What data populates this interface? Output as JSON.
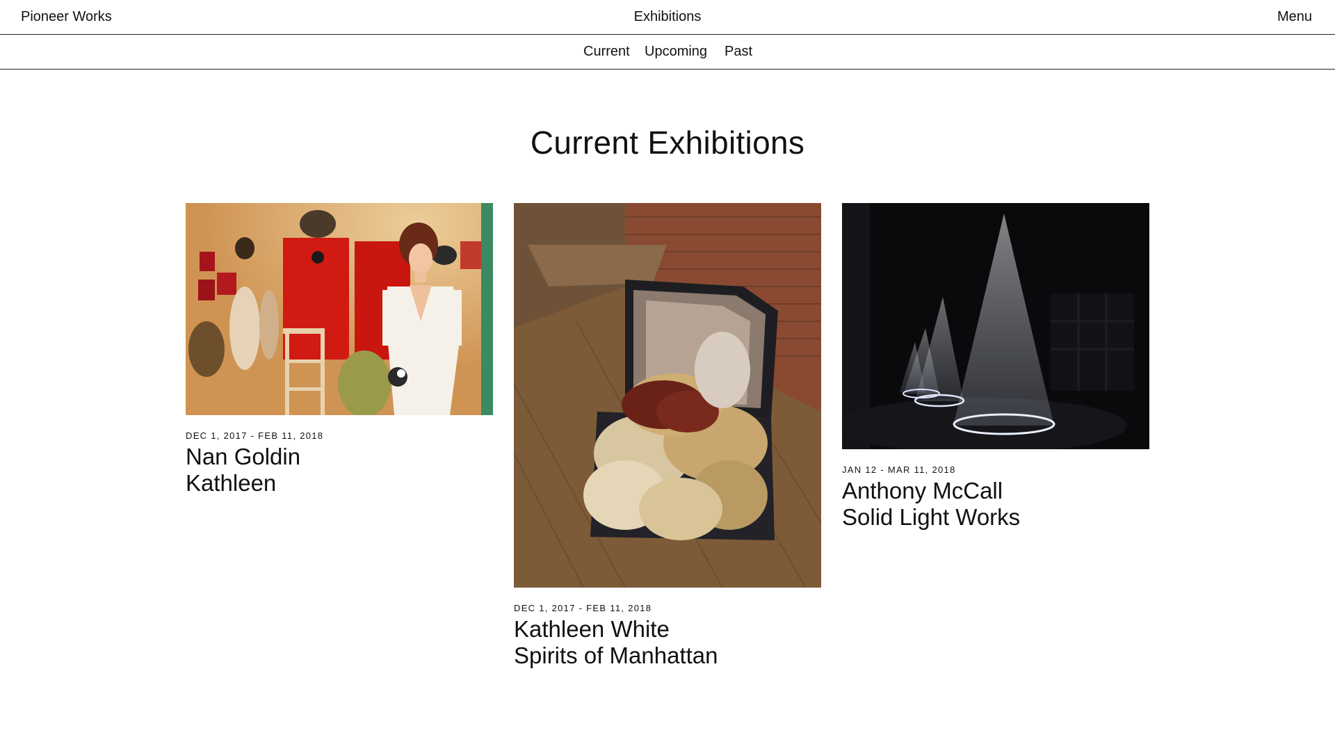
{
  "header": {
    "brand": "Pioneer Works",
    "section": "Exhibitions",
    "menu_label": "Menu"
  },
  "subnav": {
    "items": [
      {
        "label": "Current"
      },
      {
        "label": "Upcoming"
      },
      {
        "label": "Past"
      }
    ]
  },
  "main": {
    "heading": "Current Exhibitions",
    "exhibitions": [
      {
        "dates": "DEC 1, 2017 - FEB 11, 2018",
        "artist": "Nan Goldin",
        "title": "Kathleen"
      },
      {
        "dates": "DEC 1, 2017 - FEB 11, 2018",
        "artist": "Kathleen White",
        "title": "Spirits of Manhattan"
      },
      {
        "dates": "JAN 12 - MAR 11, 2018",
        "artist": "Anthony McCall",
        "title": "Solid Light Works"
      }
    ]
  }
}
